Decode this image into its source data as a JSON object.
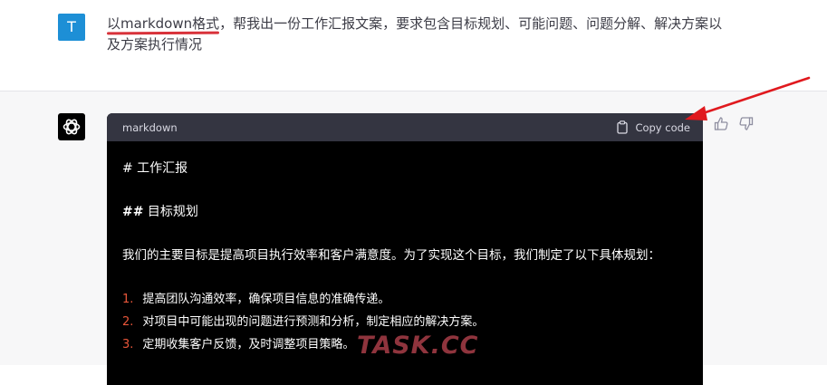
{
  "user_message": {
    "avatar_letter": "T",
    "highlight": "以markdown格式",
    "rest": "，帮我出一份工作汇报文案，要求包含目标规划、可能问题、问题分解、解决方案以及方案执行情况"
  },
  "assistant": {
    "code_language": "markdown",
    "copy_label": "Copy code",
    "lines": {
      "h1": "# 工作汇报",
      "h2_hash": "##",
      "h2_text": "目标规划",
      "para": "我们的主要目标是提高项目执行效率和客户满意度。为了实现这个目标，我们制定了以下具体规划："
    },
    "list": [
      {
        "num": "1.",
        "text": "提高团队沟通效率，确保项目信息的准确传递。"
      },
      {
        "num": "2.",
        "text": "对项目中可能出现的问题进行预测和分析，制定相应的解决方案。"
      },
      {
        "num": "3.",
        "text": "定期收集客户反馈，及时调整项目策略。"
      }
    ]
  },
  "watermark": "TASK.CC",
  "colors": {
    "user_avatar": "#1d8fd6",
    "code_bg": "#000000",
    "code_header_bg": "#343541",
    "list_number": "#e9563a",
    "annotation_red": "#d8323a",
    "assistant_bg": "#f7f7f8"
  },
  "icons": [
    "openai-logo-icon",
    "clipboard-icon",
    "thumbs-up-icon",
    "thumbs-down-icon",
    "annotation-arrow"
  ]
}
